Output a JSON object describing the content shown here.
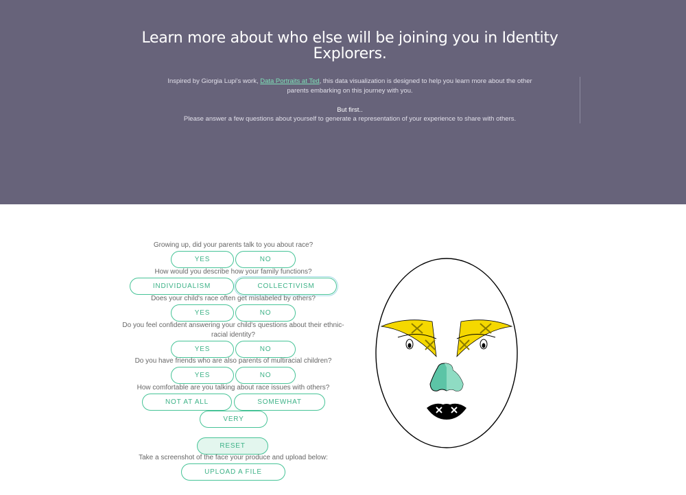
{
  "header": {
    "title": "Learn more about who else will be joining you in Identity Explorers.",
    "intro_before_link": "Inspired by Giorgia Lupi's work, ",
    "intro_link": "Data Portraits at Ted",
    "intro_after_link": ", this data visualization is designed to help you learn more about the other parents embarking on this journey with you.",
    "but_first": "But first..",
    "instruction": "Please answer a few questions about yourself to generate a representation of your experience to share with others."
  },
  "questions": {
    "q1": {
      "text": "Growing up, did your parents talk to you about race?",
      "opt1": "YES",
      "opt2": "NO"
    },
    "q2": {
      "text": "How would you describe how your family functions?",
      "opt1": "INDIVIDUALISM",
      "opt2": "COLLECTIVISM"
    },
    "q3": {
      "text": "Does your child's race often get mislabeled by others?",
      "opt1": "YES",
      "opt2": "NO"
    },
    "q4": {
      "text": "Do you feel confident answering your child's questions about their ethnic-racial identity?",
      "opt1": "YES",
      "opt2": "NO"
    },
    "q5": {
      "text": "Do you have friends who are also parents of multiracial children?",
      "opt1": "YES",
      "opt2": "NO"
    },
    "q6": {
      "text": "How comfortable are you talking about race issues with others?",
      "opt1": "NOT AT ALL",
      "opt2": "SOMEWHAT",
      "opt3": "VERY"
    }
  },
  "actions": {
    "reset": "RESET",
    "upload_prompt": "Take a screenshot of the face your produce and upload below:",
    "upload": "UPLOAD A FILE"
  },
  "colors": {
    "header_bg": "#67637a",
    "accent_green": "#45c396",
    "eyebrow_yellow": "#f5d800",
    "nose_teal": "#5cc4a6",
    "lips": "#000000"
  }
}
